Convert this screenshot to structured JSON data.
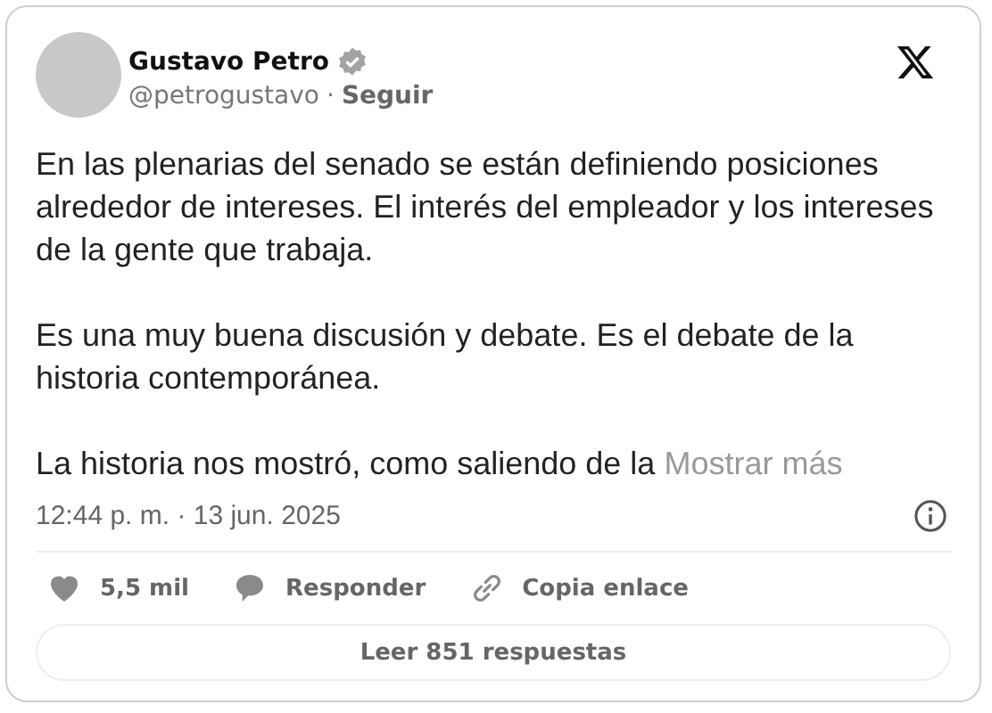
{
  "author": {
    "name": "Gustavo Petro",
    "handle": "@petrogustavo",
    "separator": "·",
    "follow": "Seguir"
  },
  "paragraphs": [
    "En las plenarias del senado se están definiendo posiciones alrededor de intereses. El interés del empleador y los intereses de la gente que trabaja.",
    "Es una muy buena discusión y debate. Es el debate de la historia contemporánea.",
    "La historia nos mostró, como saliendo de la"
  ],
  "show_more": "Mostrar más",
  "timestamp": "12:44 p. m. · 13 jun. 2025",
  "actions": [
    {
      "kind": "like",
      "label": "5,5 mil"
    },
    {
      "kind": "reply",
      "label": "Responder"
    },
    {
      "kind": "link",
      "label": "Copia enlace"
    }
  ],
  "read_replies": "Leer 851 respuestas"
}
